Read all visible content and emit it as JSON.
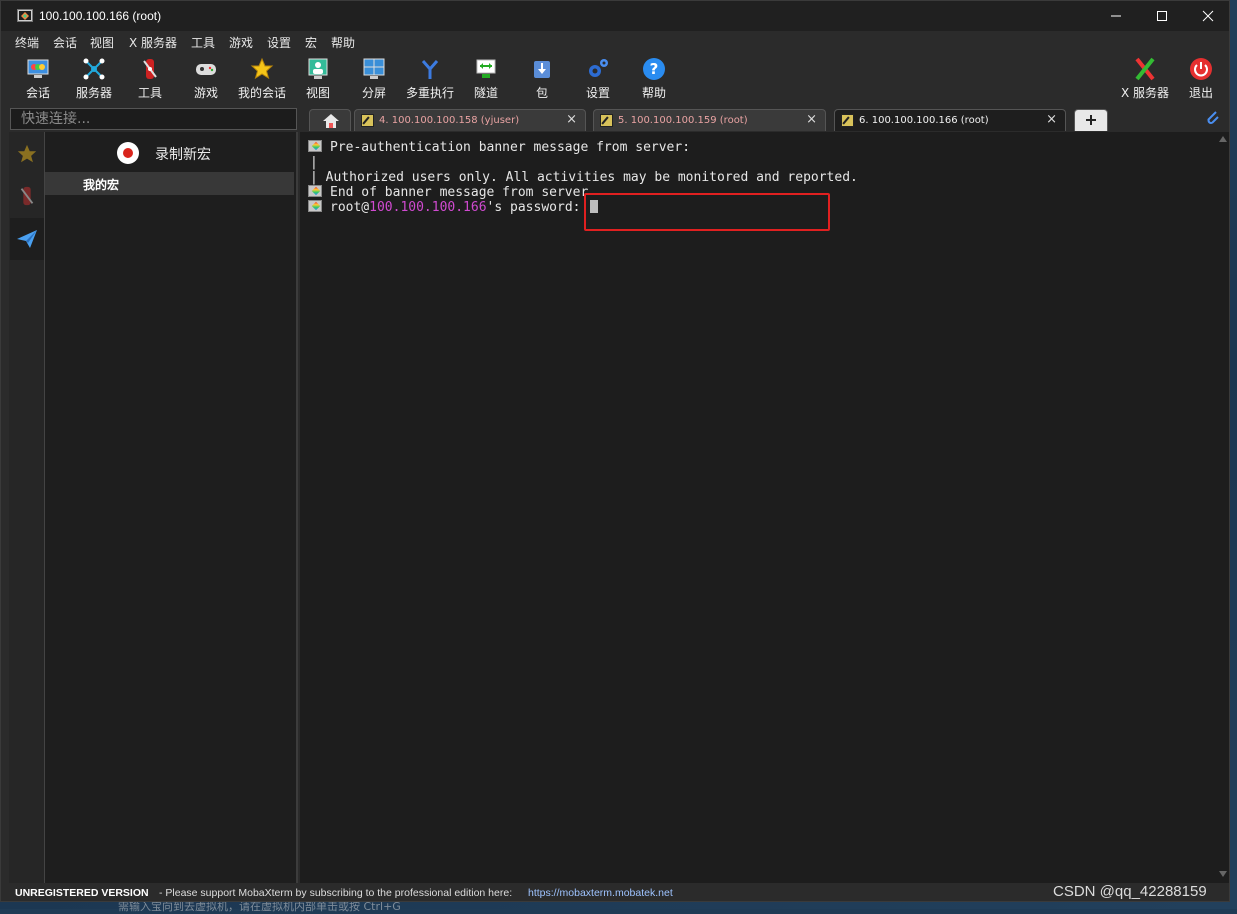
{
  "window": {
    "title": "100.100.100.166 (root)"
  },
  "menu": [
    "终端",
    "会话",
    "视图",
    "X 服务器",
    "工具",
    "游戏",
    "设置",
    "宏",
    "帮助"
  ],
  "toolbar": {
    "session": "会话",
    "servers": "服务器",
    "tools": "工具",
    "games": "游戏",
    "my_sessions": "我的会话",
    "view": "视图",
    "split": "分屏",
    "multiexec": "多重执行",
    "tunneling": "隧道",
    "packages": "包",
    "settings": "设置",
    "help": "帮助",
    "xserver": "X 服务器",
    "exit": "退出"
  },
  "quick_connect": {
    "placeholder": "快速连接..."
  },
  "tabs": [
    {
      "label": "4. 100.100.100.158 (yjuser)"
    },
    {
      "label": "5. 100.100.100.159 (root)"
    },
    {
      "label": "6. 100.100.100.166 (root)"
    }
  ],
  "macros": {
    "record_label": "录制新宏",
    "my_macros": "我的宏"
  },
  "terminal": {
    "line1": "Pre-authentication banner message from server:",
    "line2": "|",
    "line3": "| Authorized users only. All activities may be monitored and reported.",
    "line4": "End of banner message from server",
    "prompt_user": "root@",
    "prompt_host": "100.100.100.166",
    "prompt_suffix": "'s password: "
  },
  "status": {
    "unregistered": "UNREGISTERED VERSION",
    "message": "-  Please support MobaXterm by subscribing to the professional edition here:",
    "link": "https://mobaxterm.mobatek.net"
  },
  "watermark": "CSDN @qq_42288159",
  "background_text": "需输入宝向到去虚拟机，请在虚拟机内部单击或按 Ctrl+G",
  "colors": {
    "accent_highlight": "#e02020",
    "ip_color": "#d04ad0",
    "link_color": "#9ec3ff"
  }
}
